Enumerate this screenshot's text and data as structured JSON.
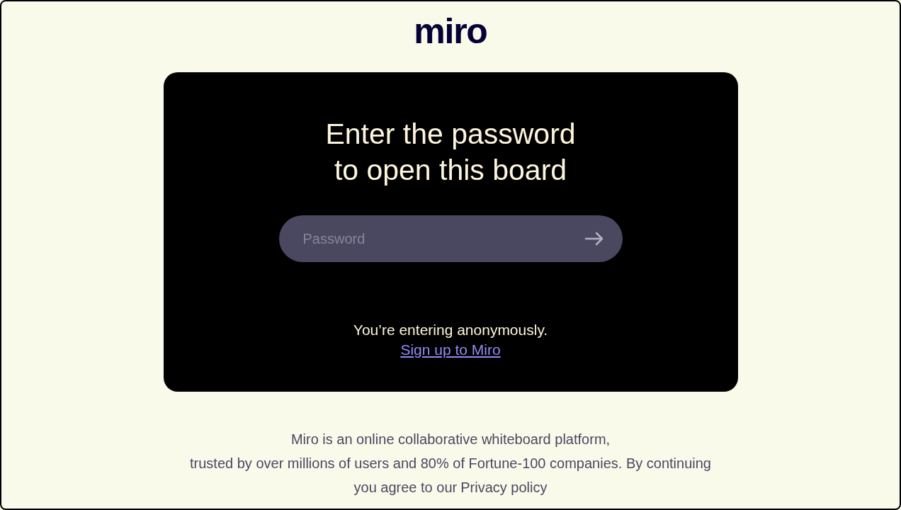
{
  "logo": "miro",
  "card": {
    "heading_lines": [
      "Enter the password",
      "to open this board"
    ],
    "password_field": {
      "placeholder": "Password"
    },
    "anonymous_note": "You’re entering anonymously.",
    "signup_link": "Sign up to Miro"
  },
  "footer": {
    "lines": [
      "Miro is an online collaborative whiteboard platform,",
      "trusted by over millions of users and 80% of Fortune-100 companies. By continuing"
    ],
    "last_line_text": "you agree to our",
    "privacy_link": "Privacy policy"
  }
}
